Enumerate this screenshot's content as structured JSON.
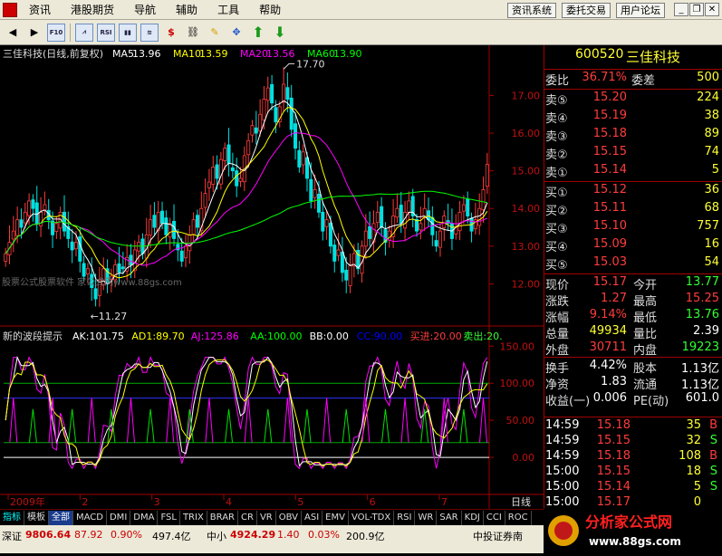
{
  "menu": {
    "items": [
      "资讯",
      "港股期货",
      "导航",
      "辅助",
      "工具",
      "帮助"
    ],
    "right_buttons": [
      "资讯系统",
      "委托交易",
      "用户论坛"
    ]
  },
  "chart_data": {
    "type": "candlestick",
    "title": "三佳科技(日线,前复权)",
    "ma": [
      {
        "name": "MA5",
        "value": "13.96",
        "color": "#ffffff"
      },
      {
        "name": "MA10",
        "value": "13.59",
        "color": "#ffff00"
      },
      {
        "name": "MA20",
        "value": "13.56",
        "color": "#ff00ff"
      },
      {
        "name": "MA60",
        "value": "13.90",
        "color": "#00ff00"
      }
    ],
    "yticks": [
      "17.00",
      "16.00",
      "15.00",
      "14.00",
      "13.00",
      "12.00"
    ],
    "ylim": [
      11.0,
      17.9
    ],
    "high_label": "17.70",
    "low_label": "11.27",
    "closes": [
      12.8,
      13.1,
      13.4,
      13.7,
      13.5,
      13.9,
      14.2,
      14.0,
      13.6,
      13.9,
      14.1,
      13.7,
      13.3,
      13.6,
      13.9,
      13.4,
      13.2,
      12.9,
      13.1,
      12.6,
      12.2,
      12.4,
      11.9,
      11.6,
      12.1,
      12.4,
      12.0,
      12.2,
      12.5,
      12.3,
      12.4,
      12.7,
      12.5,
      12.9,
      13.1,
      12.8,
      13.3,
      13.7,
      13.5,
      13.9,
      13.6,
      13.3,
      13.6,
      13.2,
      12.9,
      12.6,
      13.0,
      13.3,
      13.7,
      13.5,
      14.0,
      14.4,
      14.7,
      15.1,
      14.8,
      15.3,
      15.6,
      15.2,
      15.0,
      14.6,
      14.8,
      15.4,
      15.8,
      16.2,
      16.0,
      16.5,
      16.9,
      17.2,
      16.8,
      16.3,
      16.7,
      17.3,
      16.9,
      16.1,
      15.6,
      15.1,
      15.5,
      14.8,
      14.2,
      14.5,
      13.9,
      13.4,
      13.7,
      13.0,
      12.6,
      12.9,
      12.3,
      12.1,
      12.5,
      12.8,
      12.4,
      13.0,
      13.4,
      13.2,
      13.6,
      13.9,
      13.5,
      13.1,
      13.4,
      13.8,
      14.0,
      13.6,
      13.9,
      14.2,
      13.8,
      13.4,
      13.6,
      14.0,
      13.7,
      13.3,
      13.0,
      13.4,
      13.8,
      13.6,
      13.2,
      13.5,
      13.9,
      14.1,
      13.8,
      13.4,
      13.7,
      14.0,
      14.5,
      15.17
    ],
    "xticks": [
      "2009年",
      "2",
      "3",
      "4",
      "5",
      "6",
      "7"
    ],
    "period": "日线",
    "indicator": {
      "name": "新的波段提示",
      "items": [
        {
          "label": "AK:101.75",
          "color": "#ffffff"
        },
        {
          "label": "AD1:89.70",
          "color": "#ffff00"
        },
        {
          "label": "AJ:125.86",
          "color": "#ff00ff"
        },
        {
          "label": "AA:100.00",
          "color": "#00ff00"
        },
        {
          "label": "BB:0.00",
          "color": "#ffffff"
        },
        {
          "label": "CC:90.00",
          "color": "#0000ff"
        },
        {
          "label": "买进:20.00",
          "color": "#ff3c3c"
        },
        {
          "label": "卖出:20.",
          "color": "#33ff33"
        }
      ],
      "yticks": [
        "150.00",
        "100.00",
        "50.00",
        "0.00"
      ],
      "ylim": [
        -50,
        165
      ],
      "levels": [
        {
          "value": 100,
          "color": "#00aa00"
        },
        {
          "value": 80,
          "color": "#3030ff"
        },
        {
          "value": 20,
          "color": "#00aa00"
        },
        {
          "value": 0,
          "color": "#ffffff"
        }
      ]
    }
  },
  "watermark": "股票公式股票软件       家公式网www.88gs.com",
  "tabs": [
    "指标",
    "模板",
    "全部",
    "MACD",
    "DMI",
    "DMA",
    "FSL",
    "TRIX",
    "BRAR",
    "CR",
    "VR",
    "OBV",
    "ASI",
    "EMV",
    "VOL-TDX",
    "RSI",
    "WR",
    "SAR",
    "KDJ",
    "CCI",
    "ROC"
  ],
  "panel": {
    "code": "600520",
    "name": "三佳科技",
    "weibi": {
      "l": "委比",
      "v": "36.71%",
      "l2": "委差",
      "v2": "500"
    },
    "sells": [
      {
        "l": "卖⑤",
        "p": "15.20",
        "q": "224"
      },
      {
        "l": "卖④",
        "p": "15.19",
        "q": "38"
      },
      {
        "l": "卖③",
        "p": "15.18",
        "q": "89"
      },
      {
        "l": "卖②",
        "p": "15.15",
        "q": "74"
      },
      {
        "l": "卖①",
        "p": "15.14",
        "q": "5"
      }
    ],
    "buys": [
      {
        "l": "买①",
        "p": "15.12",
        "q": "36"
      },
      {
        "l": "买②",
        "p": "15.11",
        "q": "68"
      },
      {
        "l": "买③",
        "p": "15.10",
        "q": "757"
      },
      {
        "l": "买④",
        "p": "15.09",
        "q": "16"
      },
      {
        "l": "买⑤",
        "p": "15.03",
        "q": "54"
      }
    ],
    "quote": [
      {
        "l": "现价",
        "v": "15.17",
        "l2": "今开",
        "v2": "13.77"
      },
      {
        "l": "涨跌",
        "v": "1.27",
        "l2": "最高",
        "v2": "15.25"
      },
      {
        "l": "涨幅",
        "v": "9.14%",
        "l2": "最低",
        "v2": "13.76"
      },
      {
        "l": "总量",
        "v": "49934",
        "l2": "量比",
        "v2": "2.39"
      },
      {
        "l": "外盘",
        "v": "30711",
        "l2": "内盘",
        "v2": "19223"
      }
    ],
    "stats": [
      {
        "l": "换手",
        "v": "4.42%",
        "l2": "股本",
        "v2": "1.13亿"
      },
      {
        "l": "净资",
        "v": "1.83",
        "l2": "流通",
        "v2": "1.13亿"
      },
      {
        "l": "收益(一)",
        "v": "0.006",
        "l2": "PE(动)",
        "v2": "601.0"
      }
    ],
    "trades": [
      {
        "t": "14:59",
        "p": "15.18",
        "q": "35",
        "s": "B"
      },
      {
        "t": "14:59",
        "p": "15.15",
        "q": "32",
        "s": "S"
      },
      {
        "t": "14:59",
        "p": "15.18",
        "q": "108",
        "s": "B"
      },
      {
        "t": "15:00",
        "p": "15.15",
        "q": "18",
        "s": "S"
      },
      {
        "t": "15:00",
        "p": "15.14",
        "q": "5",
        "s": "S"
      },
      {
        "t": "15:00",
        "p": "15.17",
        "q": "0",
        "s": ""
      }
    ]
  },
  "status": {
    "sz_label": "深证",
    "sz_value": "9806.64",
    "sz_change": "87.92",
    "sz_pct": "0.90%",
    "sz_amount": "497.4亿",
    "zx_label": "中小",
    "zx_value": "4924.29",
    "zx_change": "1.40",
    "zx_pct": "0.03%",
    "zx_amount": "200.9亿",
    "broker": "中投证券南"
  },
  "logo": {
    "text": "分析家公式网",
    "url": "www.88gs.com"
  }
}
